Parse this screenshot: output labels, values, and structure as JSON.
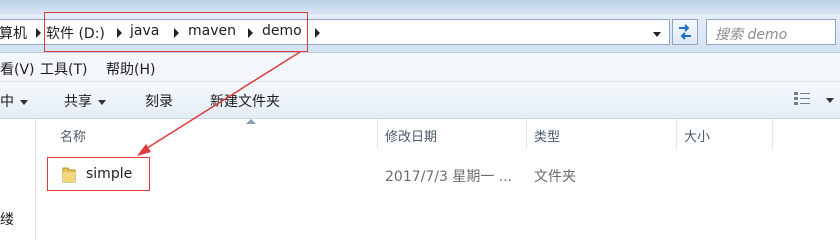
{
  "window": {
    "accent": "#e03a3a"
  },
  "address_bar": {
    "crumbs": [
      "算机",
      "软件 (D:)",
      "java",
      "maven",
      "demo"
    ],
    "refresh_icon": "refresh-icon",
    "search_placeholder": "搜索 demo"
  },
  "menu": [
    "看(V)",
    "工具(T)",
    "帮助(H)"
  ],
  "toolbar": {
    "include": "中",
    "share": "共享",
    "burn": "刻录",
    "new_folder": "新建文件夹"
  },
  "columns": [
    "名称",
    "修改日期",
    "类型",
    "大小"
  ],
  "files": [
    {
      "name": "simple",
      "modified": "2017/7/3 星期一 ...",
      "type": "文件夹",
      "size": ""
    }
  ],
  "left_pane": {
    "text": "缕"
  }
}
